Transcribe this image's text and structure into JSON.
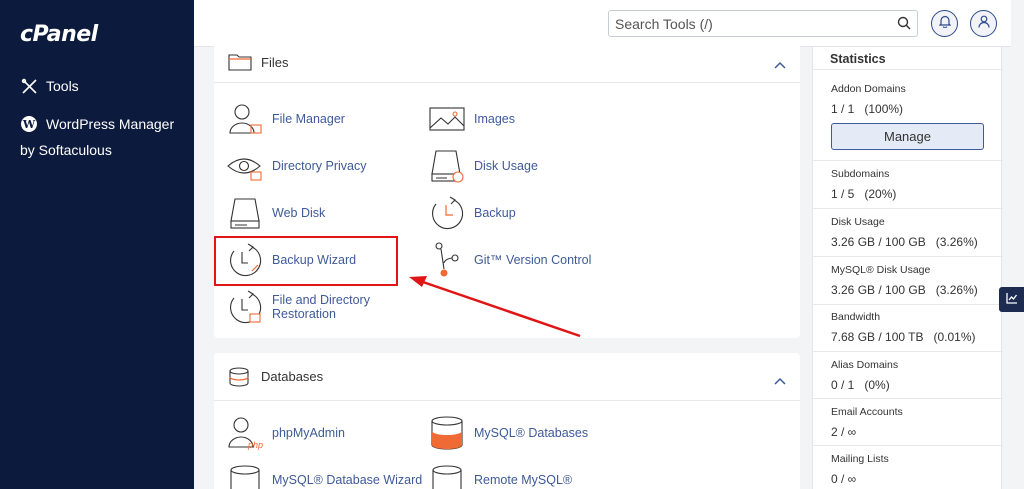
{
  "sidebar": {
    "logo": "cPanel",
    "items": [
      {
        "label": "Tools",
        "icon": "tools-icon"
      },
      {
        "label": "WordPress Manager",
        "icon": "wordpress-icon"
      }
    ],
    "wordpress_sub": "by Softaculous"
  },
  "topbar": {
    "search_placeholder": "Search Tools (/)"
  },
  "files_section": {
    "title": "Files",
    "tools": [
      {
        "label": "File Manager",
        "icon": "file-manager-icon"
      },
      {
        "label": "Images",
        "icon": "images-icon"
      },
      {
        "label": "Directory Privacy",
        "icon": "directory-privacy-icon"
      },
      {
        "label": "Disk Usage",
        "icon": "disk-usage-icon"
      },
      {
        "label": "Web Disk",
        "icon": "web-disk-icon"
      },
      {
        "label": "Backup",
        "icon": "backup-icon"
      },
      {
        "label": "Backup Wizard",
        "icon": "backup-wizard-icon"
      },
      {
        "label": "Git™ Version Control",
        "icon": "git-icon"
      },
      {
        "label_line1": "File and Directory",
        "label_line2": "Restoration",
        "icon": "file-restoration-icon"
      }
    ]
  },
  "databases_section": {
    "title": "Databases",
    "tools": [
      {
        "label": "phpMyAdmin",
        "icon": "phpmyadmin-icon"
      },
      {
        "label": "MySQL® Databases",
        "icon": "mysql-databases-icon"
      },
      {
        "label": "MySQL® Database Wizard",
        "icon": "mysql-wizard-icon"
      },
      {
        "label": "Remote MySQL®",
        "icon": "remote-mysql-icon"
      }
    ]
  },
  "statistics": {
    "title": "Statistics",
    "manage_label": "Manage",
    "items": [
      {
        "label": "Addon Domains",
        "value": "1 / 1   (100%)"
      },
      {
        "label": "Subdomains",
        "value": "1 / 5   (20%)"
      },
      {
        "label": "Disk Usage",
        "value": "3.26 GB / 100 GB   (3.26%)"
      },
      {
        "label": "MySQL® Disk Usage",
        "value": "3.26 GB / 100 GB   (3.26%)"
      },
      {
        "label": "Bandwidth",
        "value": "7.68 GB / 100 TB   (0.01%)"
      },
      {
        "label": "Alias Domains",
        "value": "0 / 1   (0%)"
      },
      {
        "label": "Email Accounts",
        "value": "2 / ∞"
      },
      {
        "label": "Mailing Lists",
        "value": "0 / ∞"
      }
    ]
  },
  "colors": {
    "sidebar_bg": "#0c1a3d",
    "link": "#3e5a98",
    "icon_accent": "#f06a35",
    "annotation_red": "#e01515"
  }
}
